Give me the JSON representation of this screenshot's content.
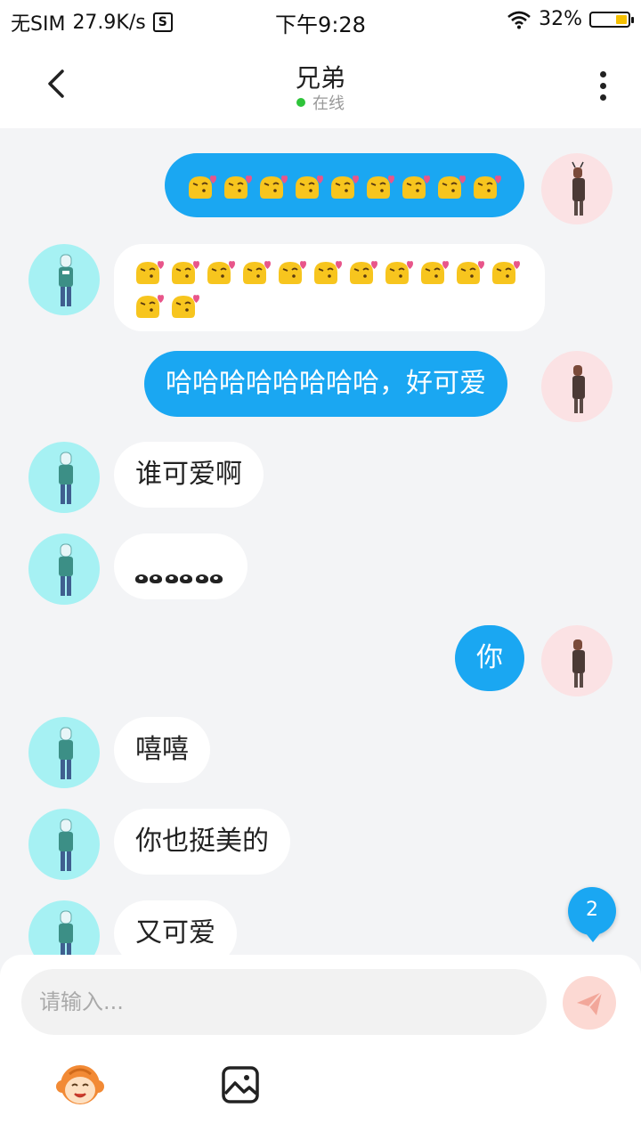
{
  "status_bar": {
    "carrier": "无SIM",
    "speed": "27.9K/s",
    "s_icon": "S",
    "time": "下午9:28",
    "battery_pct": "32%",
    "battery_level": 0.32
  },
  "header": {
    "title": "兄弟",
    "status": "在线"
  },
  "messages": [
    {
      "from": "me",
      "type": "emoji",
      "emoji": "kiss-emoji",
      "count": 9
    },
    {
      "from": "them",
      "type": "emoji",
      "emoji": "kiss-emoji",
      "count": 13
    },
    {
      "from": "me",
      "type": "text",
      "text": "哈哈哈哈哈哈哈哈，好可爱"
    },
    {
      "from": "them",
      "type": "text",
      "text": "谁可爱啊"
    },
    {
      "from": "them",
      "type": "emoji",
      "emoji": "eyes-emoji",
      "count": 3
    },
    {
      "from": "me",
      "type": "text",
      "text": "你"
    },
    {
      "from": "them",
      "type": "text",
      "text": "嘻嘻"
    },
    {
      "from": "them",
      "type": "text",
      "text": "你也挺美的"
    },
    {
      "from": "them",
      "type": "text",
      "text": "又可爱"
    }
  ],
  "unread_badge": "2",
  "composer": {
    "placeholder": "请输入..."
  },
  "icons": {
    "back": "back-icon",
    "more": "more-icon",
    "send": "send-icon",
    "emoji": "monkey-emoji-icon",
    "image": "image-icon"
  },
  "colors": {
    "accent": "#1aa7f2",
    "online": "#2ec43a",
    "background": "#f3f4f6"
  }
}
